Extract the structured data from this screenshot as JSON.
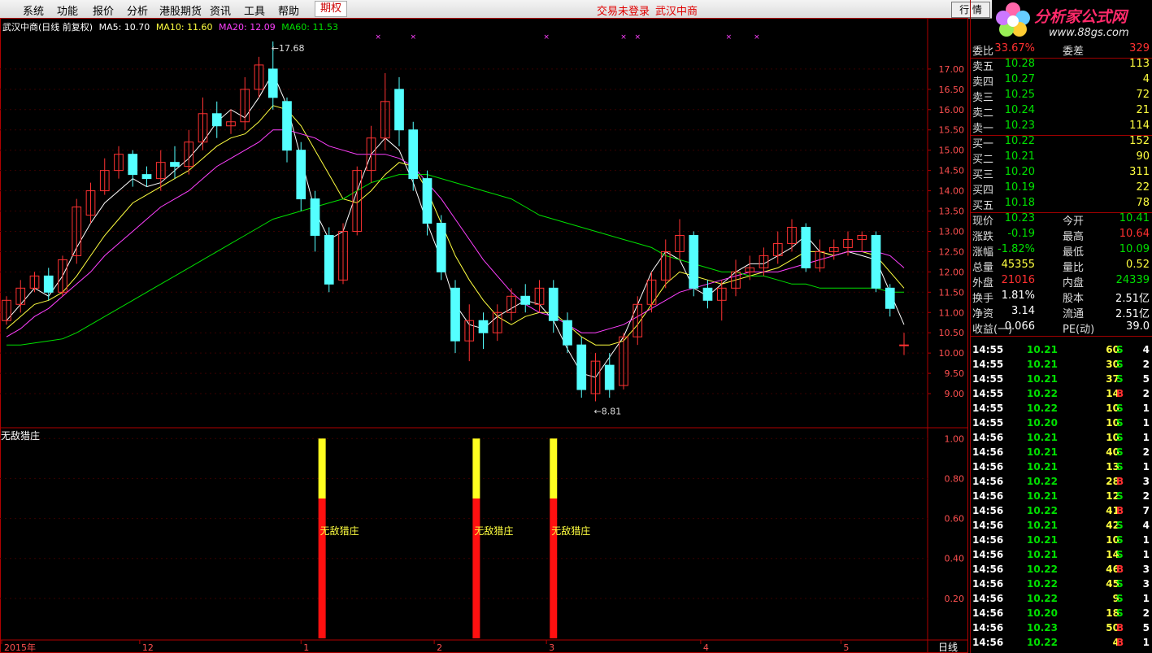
{
  "menu": {
    "items": [
      "系统",
      "功能",
      "报价",
      "分析",
      "港股期货",
      "资讯",
      "工具",
      "帮助"
    ],
    "active": "期权",
    "status_login": "交易未登录",
    "status_stock": "武汉中商",
    "quote_button": "行 情"
  },
  "logo": {
    "text": "分析家公式网",
    "url": "www.88gs.com"
  },
  "legend": {
    "name": "武汉中商",
    "mode": "(日线 前复权)",
    "ma5": "MA5: 10.70",
    "ma10": "MA10: 11.60",
    "ma20": "MA20: 12.09",
    "ma60": "MA60: 11.53"
  },
  "colors": {
    "up": "#ff3232",
    "down": "#54ffff",
    "ma5": "#ffffff",
    "ma10": "#ffff40",
    "ma20": "#ff40ff",
    "ma60": "#00e000",
    "axis": "#b00000"
  },
  "chart_data": [
    {
      "type": "candlestick",
      "title": "武汉中商",
      "ylim": [
        8.6,
        17.9
      ],
      "y_ticks": [
        "17.00",
        "16.50",
        "16.00",
        "15.50",
        "15.00",
        "14.50",
        "14.00",
        "13.50",
        "13.00",
        "12.50",
        "12.00",
        "11.50",
        "11.00",
        "10.50",
        "10.00",
        "9.50",
        "9.00"
      ],
      "x_ticks": [
        "2015年",
        "12",
        "1",
        "2",
        "3",
        "4",
        "5"
      ],
      "annotations": [
        "17.68",
        "8.81"
      ],
      "series": [
        {
          "name": "MA5",
          "values": [
            10.8,
            11.2,
            11.6,
            11.4,
            11.9,
            12.6,
            13.2,
            13.7,
            14.0,
            14.3,
            14.1,
            14.2,
            14.5,
            14.8,
            15.2,
            15.7,
            16.0,
            15.8,
            16.3,
            16.9,
            16.1,
            14.8,
            13.5,
            12.8,
            13.0,
            14.0,
            14.9,
            15.3,
            15.0,
            14.2,
            13.2,
            12.3,
            11.2,
            10.7,
            10.6,
            10.9,
            11.1,
            11.3,
            11.2,
            10.8,
            10.1,
            9.5,
            9.4,
            9.9,
            10.4,
            11.2,
            12.0,
            12.5,
            12.3,
            11.6,
            11.4,
            11.7,
            12.0,
            12.2,
            12.2,
            12.4,
            12.6,
            12.9,
            12.5,
            12.4,
            12.5,
            12.4,
            12.3,
            11.5,
            10.7
          ]
        },
        {
          "name": "MA10",
          "values": [
            10.6,
            10.9,
            11.2,
            11.3,
            11.5,
            11.9,
            12.4,
            12.9,
            13.3,
            13.7,
            13.9,
            14.1,
            14.3,
            14.5,
            14.8,
            15.1,
            15.3,
            15.4,
            15.7,
            16.1,
            16.0,
            15.6,
            15.0,
            14.4,
            13.8,
            13.7,
            14.0,
            14.4,
            14.7,
            14.6,
            14.0,
            13.2,
            12.4,
            11.8,
            11.3,
            10.9,
            10.7,
            10.9,
            11.0,
            11.0,
            10.7,
            10.4,
            10.2,
            10.2,
            10.3,
            10.7,
            11.2,
            11.7,
            12.0,
            11.9,
            11.8,
            11.7,
            11.8,
            11.9,
            12.0,
            12.1,
            12.3,
            12.5,
            12.5,
            12.4,
            12.5,
            12.5,
            12.4,
            12.0,
            11.6
          ]
        },
        {
          "name": "MA20",
          "values": [
            10.4,
            10.6,
            10.9,
            11.1,
            11.4,
            11.7,
            12.0,
            12.4,
            12.7,
            13.0,
            13.3,
            13.6,
            13.8,
            14.0,
            14.3,
            14.6,
            14.8,
            15.0,
            15.2,
            15.5,
            15.5,
            15.4,
            15.3,
            15.1,
            15.0,
            14.9,
            14.9,
            14.9,
            14.8,
            14.6,
            14.2,
            13.8,
            13.3,
            12.8,
            12.3,
            11.9,
            11.5,
            11.2,
            11.0,
            10.9,
            10.7,
            10.5,
            10.5,
            10.6,
            10.7,
            10.9,
            11.1,
            11.3,
            11.5,
            11.6,
            11.7,
            11.8,
            11.9,
            12.0,
            12.0,
            12.0,
            12.1,
            12.2,
            12.3,
            12.4,
            12.5,
            12.5,
            12.5,
            12.4,
            12.1
          ]
        },
        {
          "name": "MA60",
          "values": [
            10.2,
            10.2,
            10.25,
            10.3,
            10.35,
            10.5,
            10.7,
            10.9,
            11.1,
            11.3,
            11.5,
            11.7,
            11.9,
            12.1,
            12.3,
            12.5,
            12.7,
            12.9,
            13.1,
            13.3,
            13.4,
            13.5,
            13.6,
            13.7,
            13.8,
            14.0,
            14.2,
            14.3,
            14.4,
            14.4,
            14.4,
            14.3,
            14.2,
            14.1,
            14.0,
            13.9,
            13.8,
            13.6,
            13.4,
            13.3,
            13.2,
            13.1,
            13.0,
            12.9,
            12.8,
            12.7,
            12.6,
            12.4,
            12.3,
            12.2,
            12.1,
            12.0,
            12.0,
            11.9,
            11.9,
            11.8,
            11.7,
            11.7,
            11.6,
            11.6,
            11.6,
            11.6,
            11.6,
            11.5,
            11.5
          ]
        }
      ],
      "candles": [
        [
          10.8,
          11.3,
          10.7,
          11.4
        ],
        [
          11.2,
          11.6,
          11.0,
          11.8
        ],
        [
          11.6,
          11.9,
          11.5,
          12.0
        ],
        [
          11.9,
          11.5,
          11.3,
          12.1
        ],
        [
          11.5,
          12.3,
          11.4,
          12.4
        ],
        [
          12.4,
          13.6,
          12.2,
          13.8
        ],
        [
          13.4,
          14.0,
          13.2,
          14.2
        ],
        [
          14.0,
          14.5,
          13.9,
          14.8
        ],
        [
          14.5,
          14.9,
          14.3,
          15.1
        ],
        [
          14.9,
          14.4,
          14.1,
          15.0
        ],
        [
          14.4,
          14.3,
          14.1,
          14.6
        ],
        [
          14.3,
          14.7,
          14.0,
          15.0
        ],
        [
          14.7,
          14.6,
          14.3,
          15.1
        ],
        [
          14.6,
          15.2,
          14.4,
          15.5
        ],
        [
          15.2,
          15.9,
          15.0,
          16.3
        ],
        [
          15.9,
          15.6,
          15.3,
          16.2
        ],
        [
          15.6,
          15.7,
          15.4,
          16.0
        ],
        [
          15.7,
          16.5,
          15.5,
          16.8
        ],
        [
          16.5,
          17.1,
          16.3,
          17.3
        ],
        [
          17.0,
          16.3,
          16.0,
          17.68
        ],
        [
          16.2,
          15.0,
          14.7,
          16.3
        ],
        [
          15.0,
          13.8,
          13.5,
          15.2
        ],
        [
          13.8,
          12.9,
          12.5,
          14.0
        ],
        [
          12.9,
          11.7,
          11.5,
          13.1
        ],
        [
          11.8,
          13.0,
          11.7,
          13.2
        ],
        [
          13.0,
          14.5,
          12.9,
          14.6
        ],
        [
          14.5,
          15.3,
          14.2,
          15.6
        ],
        [
          15.3,
          16.2,
          15.0,
          16.9
        ],
        [
          16.5,
          15.5,
          15.1,
          16.8
        ],
        [
          15.5,
          14.3,
          14.0,
          15.7
        ],
        [
          14.3,
          13.2,
          12.9,
          14.5
        ],
        [
          13.2,
          12.0,
          11.8,
          13.4
        ],
        [
          11.6,
          10.3,
          10.0,
          11.8
        ],
        [
          10.3,
          10.8,
          9.8,
          11.2
        ],
        [
          10.8,
          10.5,
          10.1,
          11.0
        ],
        [
          10.5,
          11.0,
          10.3,
          11.2
        ],
        [
          11.0,
          11.4,
          10.8,
          11.6
        ],
        [
          11.4,
          11.2,
          11.0,
          11.7
        ],
        [
          11.2,
          11.6,
          11.0,
          11.8
        ],
        [
          11.6,
          10.8,
          10.5,
          11.8
        ],
        [
          10.8,
          10.2,
          10.0,
          11.0
        ],
        [
          10.2,
          9.1,
          8.9,
          10.4
        ],
        [
          9.0,
          9.8,
          8.81,
          10.0
        ],
        [
          9.7,
          9.1,
          8.9,
          10.0
        ],
        [
          9.2,
          10.4,
          9.1,
          10.5
        ],
        [
          10.4,
          11.2,
          10.2,
          11.4
        ],
        [
          11.2,
          11.8,
          11.0,
          12.0
        ],
        [
          11.8,
          12.5,
          11.6,
          12.8
        ],
        [
          12.5,
          12.9,
          12.3,
          13.3
        ],
        [
          12.9,
          11.6,
          11.4,
          13.0
        ],
        [
          11.6,
          11.3,
          11.1,
          11.8
        ],
        [
          11.3,
          11.6,
          10.8,
          11.8
        ],
        [
          11.6,
          12.0,
          11.4,
          12.3
        ],
        [
          12.0,
          12.1,
          11.8,
          12.4
        ],
        [
          12.1,
          12.4,
          11.9,
          12.6
        ],
        [
          12.4,
          12.7,
          12.2,
          13.0
        ],
        [
          12.7,
          13.1,
          12.5,
          13.3
        ],
        [
          13.1,
          12.1,
          12.0,
          13.2
        ],
        [
          12.1,
          12.5,
          12.0,
          12.8
        ],
        [
          12.5,
          12.6,
          12.3,
          12.8
        ],
        [
          12.6,
          12.8,
          12.4,
          13.0
        ],
        [
          12.8,
          12.9,
          12.5,
          13.0
        ],
        [
          12.9,
          11.6,
          11.5,
          13.0
        ],
        [
          11.6,
          11.1,
          10.9,
          11.7
        ],
        [
          10.2,
          10.2,
          9.95,
          10.5
        ]
      ]
    },
    {
      "type": "bar",
      "title": "无敌猎庄",
      "ylim": [
        0,
        1.05
      ],
      "y_ticks": [
        "1.00",
        "0.80",
        "0.60",
        "0.40",
        "0.20"
      ],
      "signals": [
        {
          "label": "无敌猎庄",
          "value": 1.0,
          "split": 0.7
        },
        {
          "label": "无敌猎庄",
          "value": 1.0,
          "split": 0.7
        },
        {
          "label": "无敌猎庄",
          "value": 1.0,
          "split": 0.7
        }
      ],
      "period_label": "日线"
    }
  ],
  "quote": {
    "weibi": {
      "label": "委比",
      "value": "33.67%",
      "label2": "委差",
      "value2": "329"
    },
    "sells": [
      {
        "label": "卖五",
        "price": "10.28",
        "vol": "113"
      },
      {
        "label": "卖四",
        "price": "10.27",
        "vol": "4"
      },
      {
        "label": "卖三",
        "price": "10.25",
        "vol": "72"
      },
      {
        "label": "卖二",
        "price": "10.24",
        "vol": "21"
      },
      {
        "label": "卖一",
        "price": "10.23",
        "vol": "114"
      }
    ],
    "buys": [
      {
        "label": "买一",
        "price": "10.22",
        "vol": "152"
      },
      {
        "label": "买二",
        "price": "10.21",
        "vol": "90"
      },
      {
        "label": "买三",
        "price": "10.20",
        "vol": "311"
      },
      {
        "label": "买四",
        "price": "10.19",
        "vol": "22"
      },
      {
        "label": "买五",
        "price": "10.18",
        "vol": "78"
      }
    ],
    "stats": [
      {
        "l": "现价",
        "v": "10.23",
        "c": "green",
        "l2": "今开",
        "v2": "10.41",
        "c2": "green"
      },
      {
        "l": "涨跌",
        "v": "-0.19",
        "c": "green",
        "l2": "最高",
        "v2": "10.64",
        "c2": "red"
      },
      {
        "l": "涨幅",
        "v": "-1.82%",
        "c": "green",
        "l2": "最低",
        "v2": "10.09",
        "c2": "green"
      },
      {
        "l": "总量",
        "v": "45355",
        "c": "yellow",
        "l2": "量比",
        "v2": "0.52",
        "c2": "yellow"
      },
      {
        "l": "外盘",
        "v": "21016",
        "c": "red",
        "l2": "内盘",
        "v2": "24339",
        "c2": "green"
      },
      {
        "l": "换手",
        "v": "1.81%",
        "c": "white",
        "l2": "股本",
        "v2": "2.51亿",
        "c2": "white"
      },
      {
        "l": "净资",
        "v": "3.14",
        "c": "white",
        "l2": "流通",
        "v2": "2.51亿",
        "c2": "white"
      },
      {
        "l": "收益(一)",
        "v": "0.066",
        "c": "white",
        "l2": "PE(动)",
        "v2": "39.0",
        "c2": "white"
      }
    ],
    "ticks": [
      {
        "t": "14:55",
        "p": "10.21",
        "v": "60",
        "s": "S",
        "n": "4"
      },
      {
        "t": "14:55",
        "p": "10.21",
        "v": "30",
        "s": "S",
        "n": "2"
      },
      {
        "t": "14:55",
        "p": "10.21",
        "v": "37",
        "s": "S",
        "n": "5"
      },
      {
        "t": "14:55",
        "p": "10.22",
        "v": "14",
        "s": "B",
        "n": "2"
      },
      {
        "t": "14:55",
        "p": "10.22",
        "v": "10",
        "s": "S",
        "n": "1"
      },
      {
        "t": "14:55",
        "p": "10.20",
        "v": "10",
        "s": "S",
        "n": "1"
      },
      {
        "t": "14:56",
        "p": "10.21",
        "v": "10",
        "s": "S",
        "n": "1"
      },
      {
        "t": "14:56",
        "p": "10.21",
        "v": "40",
        "s": "S",
        "n": "2"
      },
      {
        "t": "14:56",
        "p": "10.21",
        "v": "13",
        "s": "S",
        "n": "1"
      },
      {
        "t": "14:56",
        "p": "10.22",
        "v": "28",
        "s": "B",
        "n": "3"
      },
      {
        "t": "14:56",
        "p": "10.21",
        "v": "12",
        "s": "S",
        "n": "2"
      },
      {
        "t": "14:56",
        "p": "10.22",
        "v": "41",
        "s": "B",
        "n": "7"
      },
      {
        "t": "14:56",
        "p": "10.21",
        "v": "42",
        "s": "S",
        "n": "4"
      },
      {
        "t": "14:56",
        "p": "10.21",
        "v": "10",
        "s": "S",
        "n": "1"
      },
      {
        "t": "14:56",
        "p": "10.21",
        "v": "14",
        "s": "S",
        "n": "1"
      },
      {
        "t": "14:56",
        "p": "10.22",
        "v": "46",
        "s": "B",
        "n": "3"
      },
      {
        "t": "14:56",
        "p": "10.22",
        "v": "45",
        "s": "S",
        "n": "3"
      },
      {
        "t": "14:56",
        "p": "10.22",
        "v": "9",
        "s": "S",
        "n": "1"
      },
      {
        "t": "14:56",
        "p": "10.20",
        "v": "18",
        "s": "S",
        "n": "2"
      },
      {
        "t": "14:56",
        "p": "10.23",
        "v": "50",
        "s": "B",
        "n": "5"
      },
      {
        "t": "14:56",
        "p": "10.22",
        "v": "4",
        "s": "B",
        "n": "1"
      }
    ]
  }
}
